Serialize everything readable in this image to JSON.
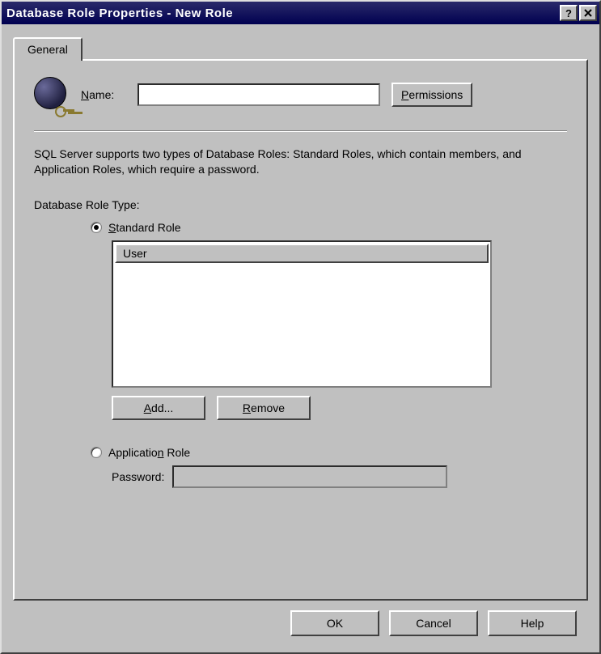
{
  "window": {
    "title": "Database Role Properties - New Role"
  },
  "tabs": {
    "general": "General"
  },
  "name": {
    "label": "Name:",
    "value": ""
  },
  "permissions_btn": "Permissions",
  "description": "SQL Server supports two types of Database Roles: Standard Roles, which contain members, and Application Roles, which require a password.",
  "role_type": {
    "label": "Database Role Type:",
    "standard": "Standard Role",
    "application": "Application Role",
    "selected": "standard"
  },
  "userlist": {
    "header": "User",
    "items": []
  },
  "buttons": {
    "add": "Add...",
    "remove": "Remove",
    "ok": "OK",
    "cancel": "Cancel",
    "help": "Help"
  },
  "password": {
    "label": "Password:",
    "value": ""
  }
}
